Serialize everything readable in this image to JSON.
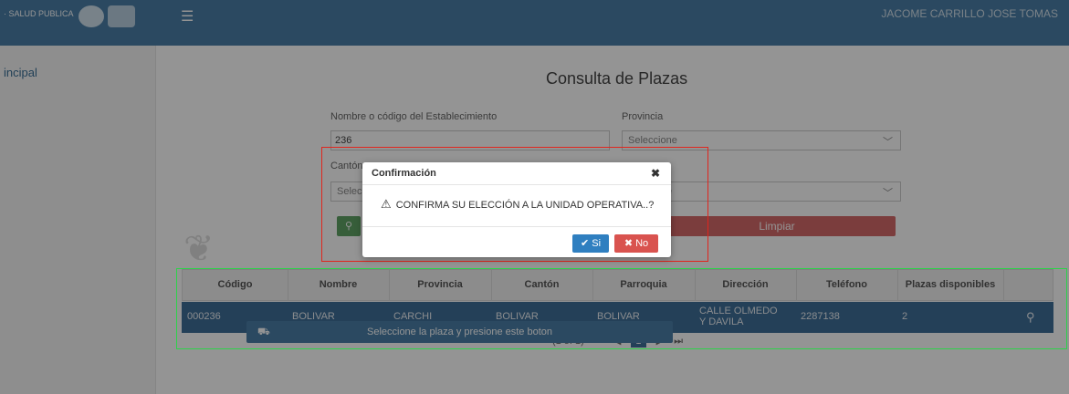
{
  "header": {
    "brand": "· SALUD PUBLICA",
    "user": "JACOME CARRILLO JOSE TOMAS"
  },
  "sidebar": {
    "items": [
      {
        "label": "incipal"
      }
    ]
  },
  "main": {
    "title": "Consulta de Plazas",
    "form": {
      "establecimiento_label": "Nombre o código del Establecimiento",
      "establecimiento_value": "236",
      "provincia_label": "Provincia",
      "provincia_value": "Seleccione",
      "canton_label": "Cantón",
      "canton_value": "Selec",
      "parroquia_value": "e",
      "clear_label": "Limpiar"
    },
    "table": {
      "headers": [
        "Código",
        "Nombre",
        "Provincia",
        "Cantón",
        "Parroquia",
        "Dirección",
        "Teléfono",
        "Plazas disponibles"
      ],
      "rows": [
        [
          "000236",
          "BOLIVAR",
          "CARCHI",
          "BOLIVAR",
          "BOLIVAR",
          "CALLE OLMEDO Y DAVILA",
          "2287138",
          "2"
        ]
      ],
      "pagination": {
        "status": "(1 of 1)",
        "first": "⏮",
        "prev": "◀",
        "current": "1",
        "next": "▶",
        "last": "⏭"
      }
    },
    "select_button_label": "Seleccione la plaza y presione este boton"
  },
  "modal": {
    "title": "Confirmación",
    "message": "CONFIRMA SU ELECCIÓN A LA UNIDAD OPERATIVA..?",
    "yes_label": "Si",
    "no_label": "No"
  },
  "colors": {
    "header_bg": "#4a7fa8",
    "row_selected": "#3f6f98",
    "annotation_red": "#e0261e",
    "annotation_green": "#2ed24a",
    "yes_button": "#2f7fc0",
    "no_button": "#d9534f"
  }
}
